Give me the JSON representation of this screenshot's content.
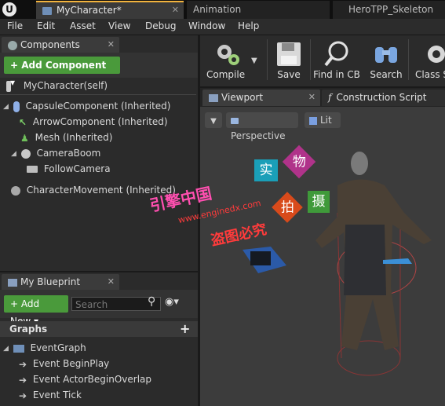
{
  "tabs": {
    "active": "MyCharacter*",
    "animation": "Animation",
    "skeleton": "HeroTPP_Skeleton"
  },
  "menu": [
    "File",
    "Edit",
    "Asset",
    "View",
    "Debug",
    "Window",
    "Help"
  ],
  "components_panel": {
    "title": "Components",
    "add_component": "+ Add Component ▾",
    "tree": [
      "MyCharacter(self)",
      "CapsuleComponent (Inherited)",
      "ArrowComponent (Inherited)",
      "Mesh (Inherited)",
      "CameraBoom",
      "FollowCamera",
      "CharacterMovement (Inherited)"
    ]
  },
  "toolbar": {
    "compile": "Compile",
    "save": "Save",
    "find_in_cb": "Find in CB",
    "search": "Search",
    "class_settings": "Class S"
  },
  "viewport_tabs": {
    "viewport": "Viewport",
    "construction_script": "Construction Script"
  },
  "viewport": {
    "perspective": "Perspective",
    "lit": "Lit"
  },
  "my_blueprint": {
    "title": "My Blueprint",
    "add_new": "+ Add New ▾",
    "search_placeholder": "Search",
    "graphs_label": "Graphs",
    "event_graph": "EventGraph",
    "events": [
      "Event BeginPlay",
      "Event ActorBeginOverlap",
      "Event Tick"
    ]
  },
  "watermark": {
    "chars": [
      "实",
      "物",
      "拍",
      "摄"
    ],
    "line1": "引擎中国",
    "url": "www.enginedx.com",
    "line2": "盗图必究"
  },
  "colors": {
    "accent_tab": "#f2b33d",
    "green_button": "#4a9a3b"
  }
}
